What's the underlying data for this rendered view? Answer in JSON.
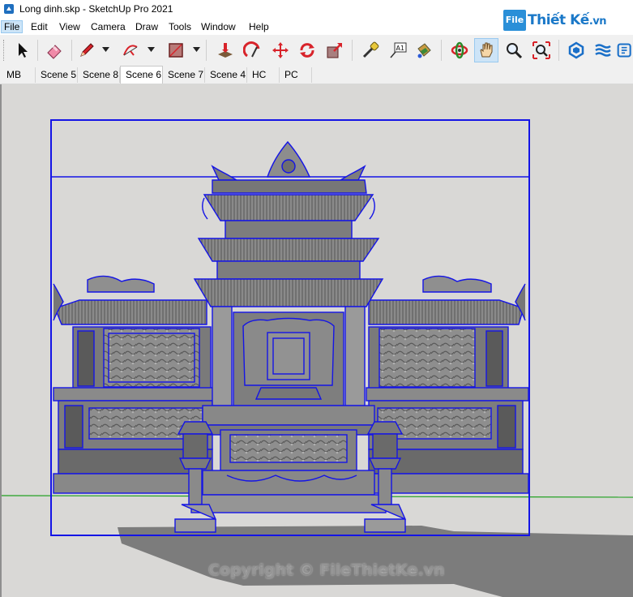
{
  "window": {
    "title": "Long dinh.skp - SketchUp Pro 2021"
  },
  "menu": {
    "items": [
      "File",
      "Edit",
      "View",
      "Camera",
      "Draw",
      "Tools",
      "Window",
      "Help"
    ]
  },
  "logo": {
    "box_text": "File",
    "text": "Thiết Kế",
    "suffix": ".vn"
  },
  "toolbar": {
    "tools": [
      "select-icon",
      "eraser-icon",
      "pencil-icon",
      "arc-icon",
      "rectangle-icon",
      "push-pull-icon",
      "follow-me-icon",
      "move-icon",
      "rotate-icon",
      "scale-icon",
      "tape-measure-icon",
      "text-icon",
      "paint-bucket-icon",
      "orbit-icon",
      "pan-icon",
      "zoom-icon",
      "zoom-extents-icon",
      "sandbox-icon",
      "layers-icon",
      "model-info-icon"
    ]
  },
  "scenes": {
    "tabs": [
      "MB",
      "Scene 5",
      "Scene 8",
      "Scene 6",
      "Scene 7",
      "Scene 4",
      "HC",
      "PC"
    ],
    "active": "Scene 6"
  },
  "viewport": {
    "watermark": "Copyright © FileThietKe.vn"
  },
  "colors": {
    "selection": "#1414e6",
    "model": "#6e6e6e",
    "axis_green": "#1fa01f",
    "shadow": "#7a7a7a"
  }
}
